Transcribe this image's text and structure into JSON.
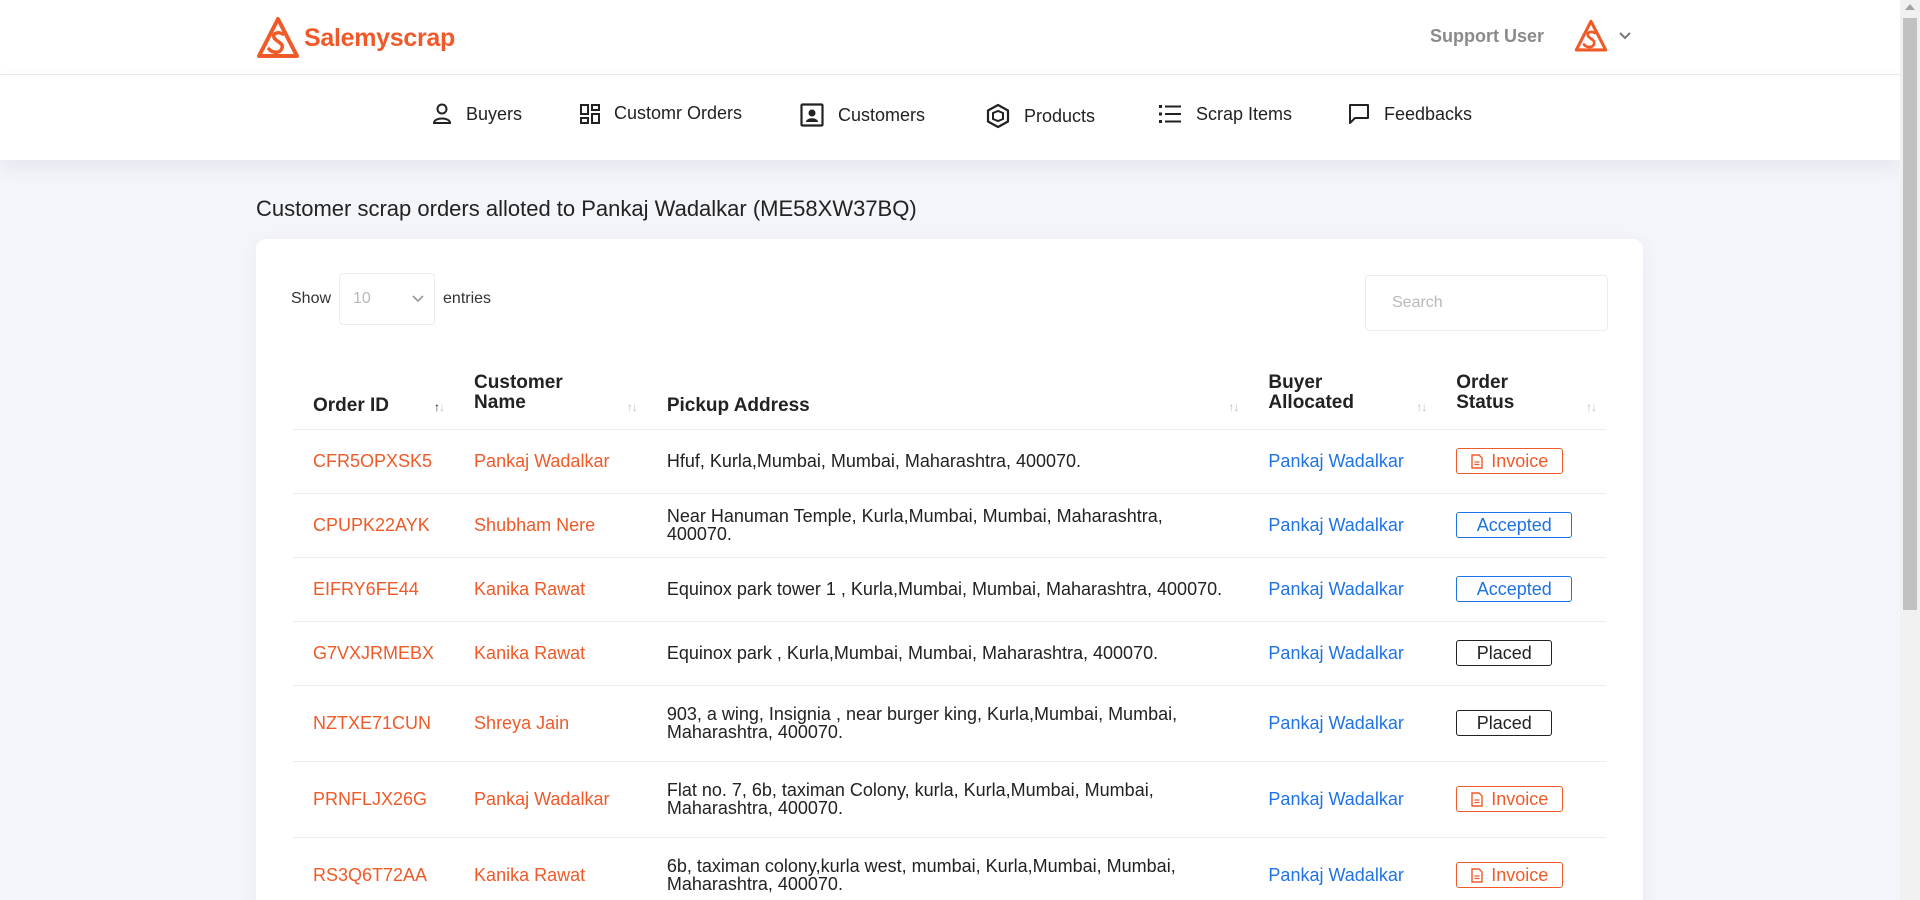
{
  "brand": {
    "name": "Salemyscrap",
    "color": "#f05a28"
  },
  "header": {
    "user_name": "Support User"
  },
  "nav": [
    {
      "label": "Buyers",
      "icon": "user-icon"
    },
    {
      "label": "Customr Orders",
      "icon": "dashboard-icon"
    },
    {
      "label": "Customers",
      "icon": "contact-card-icon"
    },
    {
      "label": "Products",
      "icon": "package-icon"
    },
    {
      "label": "Scrap Items",
      "icon": "list-icon"
    },
    {
      "label": "Feedbacks",
      "icon": "message-icon"
    }
  ],
  "page": {
    "title": "Customer scrap orders alloted to Pankaj Wadalkar (ME58XW37BQ)"
  },
  "table_controls": {
    "show_label": "Show",
    "entries_value": "10",
    "entries_label": "entries",
    "search_placeholder": "Search"
  },
  "table": {
    "columns": [
      {
        "line1": "Order ID",
        "line2": ""
      },
      {
        "line1": "Customer",
        "line2": "Name"
      },
      {
        "line1": "Pickup Address",
        "line2": ""
      },
      {
        "line1": "Buyer",
        "line2": "Allocated"
      },
      {
        "line1": "Order",
        "line2": "Status"
      }
    ],
    "rows": [
      {
        "order_id": "CFR5OPXSK5",
        "customer": "Pankaj Wadalkar",
        "address": "Hfuf, Kurla,Mumbai, Mumbai, Maharashtra, 400070.",
        "buyer": "Pankaj Wadalkar",
        "status": "Invoice"
      },
      {
        "order_id": "CPUPK22AYK",
        "customer": "Shubham Nere",
        "address": "Near Hanuman Temple, Kurla,Mumbai, Mumbai, Maharashtra, 400070.",
        "buyer": "Pankaj Wadalkar",
        "status": "Accepted"
      },
      {
        "order_id": "EIFRY6FE44",
        "customer": "Kanika Rawat",
        "address": "Equinox park tower 1 , Kurla,Mumbai, Mumbai, Maharashtra, 400070.",
        "buyer": "Pankaj Wadalkar",
        "status": "Accepted"
      },
      {
        "order_id": "G7VXJRMEBX",
        "customer": "Kanika Rawat",
        "address": "Equinox park , Kurla,Mumbai, Mumbai, Maharashtra, 400070.",
        "buyer": "Pankaj Wadalkar",
        "status": "Placed"
      },
      {
        "order_id": "NZTXE71CUN",
        "customer": "Shreya Jain",
        "address": "903, a wing, Insignia , near burger king, Kurla,Mumbai, Mumbai, Maharashtra, 400070.",
        "buyer": "Pankaj Wadalkar",
        "status": "Placed"
      },
      {
        "order_id": "PRNFLJX26G",
        "customer": "Pankaj Wadalkar",
        "address": "Flat no. 7, 6b, taximan Colony, kurla, Kurla,Mumbai, Mumbai, Maharashtra, 400070.",
        "buyer": "Pankaj Wadalkar",
        "status": "Invoice"
      },
      {
        "order_id": "RS3Q6T72AA",
        "customer": "Kanika Rawat",
        "address": "6b, taximan colony,kurla west, mumbai, Kurla,Mumbai, Mumbai, Maharashtra, 400070.",
        "buyer": "Pankaj Wadalkar",
        "status": "Invoice"
      }
    ]
  },
  "colors": {
    "accent": "#f05a28",
    "link_blue": "#1e73e8",
    "background": "#f4f5fa"
  }
}
